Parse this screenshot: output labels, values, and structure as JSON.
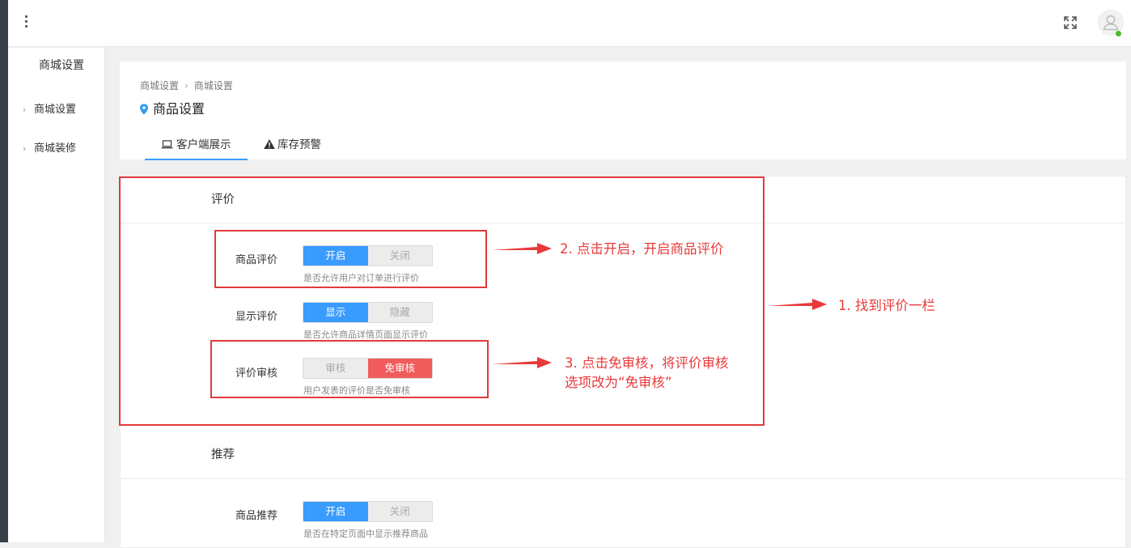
{
  "sidebar": {
    "title": "商城设置",
    "items": [
      {
        "label": "商城设置"
      },
      {
        "label": "商城装修"
      }
    ]
  },
  "breadcrumb": [
    "商城设置",
    "商城设置"
  ],
  "page_title": "商品设置",
  "tabs": [
    {
      "label": "客户端展示",
      "icon": "laptop-icon",
      "active": true
    },
    {
      "label": "库存预警",
      "icon": "warning-icon",
      "active": false
    }
  ],
  "sections": [
    {
      "title": "评价",
      "rows": [
        {
          "label": "商品评价",
          "options": [
            "开启",
            "关闭"
          ],
          "selected": "开启",
          "hint": "是否允许用户对订单进行评价"
        },
        {
          "label": "显示评价",
          "options": [
            "显示",
            "隐藏"
          ],
          "selected": "显示",
          "hint": "是否允许商品详情页面显示评价"
        },
        {
          "label": "评价审核",
          "options": [
            "审核",
            "免审核"
          ],
          "selected": "免审核",
          "hint": "用户发表的评价是否免审核"
        }
      ]
    },
    {
      "title": "推荐",
      "rows": [
        {
          "label": "商品推荐",
          "options": [
            "开启",
            "关闭"
          ],
          "selected": "开启",
          "hint": "是否在特定页面中显示推荐商品"
        }
      ]
    }
  ],
  "annotations": {
    "a1": "1. 找到评价一栏",
    "a2": "2. 点击开启，开启商品评价",
    "a3_line1": "3. 点击免审核，将评价审核",
    "a3_line2": "选项改为“免审核”"
  },
  "colors": {
    "accent": "#3a9bff",
    "danger": "#f05b5b",
    "annotation": "#e83a3a"
  }
}
